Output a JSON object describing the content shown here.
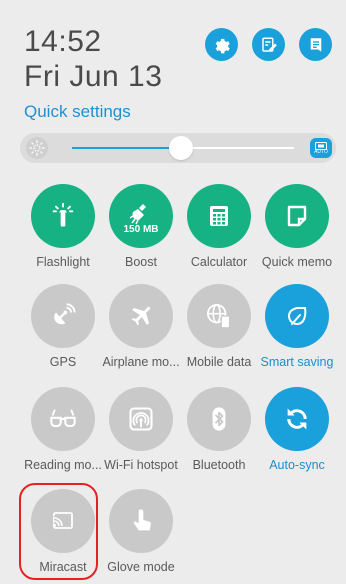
{
  "header": {
    "time": "14:52",
    "date": "Fri Jun 13",
    "quick_settings_label": "Quick settings"
  },
  "top_icons": [
    "settings-icon",
    "edit-icon",
    "notes-icon"
  ],
  "brightness": {
    "level_fraction": 0.49,
    "auto_label": "AUTO"
  },
  "tiles": [
    {
      "label": "Flashlight",
      "icon": "flashlight-icon",
      "state": "on"
    },
    {
      "label": "Boost",
      "icon": "broom-icon",
      "state": "on",
      "sub": "150 MB"
    },
    {
      "label": "Calculator",
      "icon": "calculator-icon",
      "state": "on"
    },
    {
      "label": "Quick memo",
      "icon": "memo-icon",
      "state": "on"
    },
    {
      "label": "GPS",
      "icon": "gps-icon",
      "state": "off"
    },
    {
      "label": "Airplane mo...",
      "icon": "airplane-icon",
      "state": "off"
    },
    {
      "label": "Mobile data",
      "icon": "mobile-data-icon",
      "state": "off"
    },
    {
      "label": "Smart saving",
      "icon": "leaf-icon",
      "state": "active"
    },
    {
      "label": "Reading mo...",
      "icon": "glasses-icon",
      "state": "off"
    },
    {
      "label": "Wi-Fi hotspot",
      "icon": "hotspot-icon",
      "state": "off"
    },
    {
      "label": "Bluetooth",
      "icon": "bluetooth-icon",
      "state": "off"
    },
    {
      "label": "Auto-sync",
      "icon": "sync-icon",
      "state": "active"
    },
    {
      "label": "Miracast",
      "icon": "cast-icon",
      "state": "off"
    },
    {
      "label": "Glove mode",
      "icon": "glove-icon",
      "state": "off"
    }
  ],
  "colors": {
    "green": "#17b283",
    "blue": "#1aa0da",
    "grey": "#c9c9c9",
    "highlight": "#e32222"
  }
}
